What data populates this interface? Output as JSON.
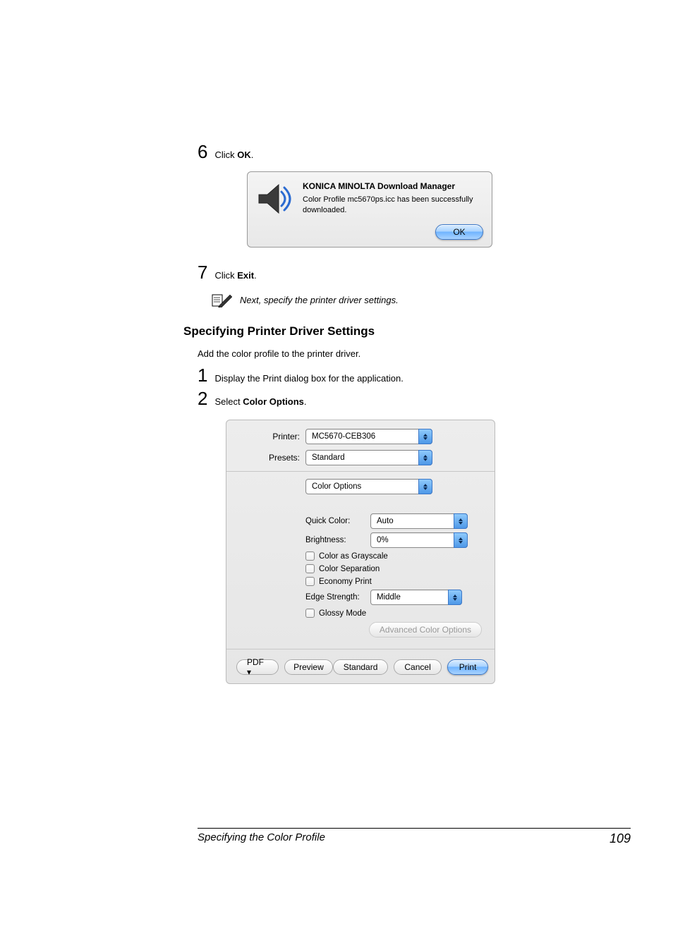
{
  "step6": {
    "num": "6",
    "pre": "Click ",
    "bold": "OK",
    "post": "."
  },
  "dialog1": {
    "title": "KONICA MINOLTA Download Manager",
    "message": "Color Profile mc5670ps.icc has been successfully downloaded.",
    "ok": "OK"
  },
  "step7": {
    "num": "7",
    "pre": "Click ",
    "bold": "Exit",
    "post": "."
  },
  "note": "Next, specify the printer driver settings.",
  "heading": "Specifying Printer Driver Settings",
  "intro": "Add the color profile to the printer driver.",
  "step1": {
    "num": "1",
    "text": "Display the Print dialog box for the application."
  },
  "step2": {
    "num": "2",
    "pre": "Select ",
    "bold": "Color Options",
    "post": "."
  },
  "dialog2": {
    "printer_label": "Printer:",
    "printer_value": "MC5670-CEB306",
    "presets_label": "Presets:",
    "presets_value": "Standard",
    "pane_value": "Color Options",
    "quick_color_label": "Quick Color:",
    "quick_color_value": "Auto",
    "brightness_label": "Brightness:",
    "brightness_value": "0%",
    "color_grayscale": "Color as Grayscale",
    "color_separation": "Color Separation",
    "economy_print": "Economy Print",
    "edge_strength_label": "Edge Strength:",
    "edge_strength_value": "Middle",
    "glossy_mode": "Glossy Mode",
    "advanced": "Advanced Color Options",
    "pdf": "PDF ▾",
    "preview": "Preview",
    "standard": "Standard",
    "cancel": "Cancel",
    "print": "Print"
  },
  "footer": {
    "title": "Specifying the Color Profile",
    "page": "109"
  }
}
